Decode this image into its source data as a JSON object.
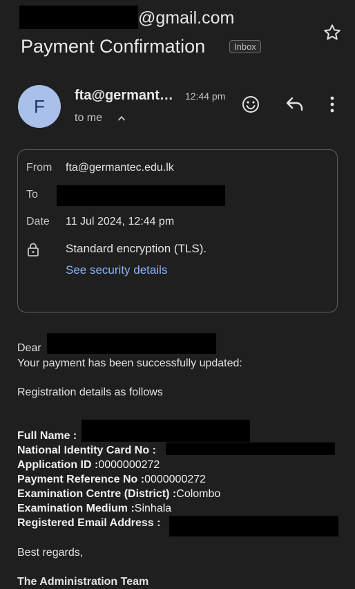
{
  "header": {
    "account_email": "@gmail.com",
    "subject": "Payment Confirmation",
    "label": "Inbox"
  },
  "message": {
    "avatar_letter": "F",
    "sender": "fta@germant…",
    "time": "12:44 pm",
    "to_me": "to me"
  },
  "details": {
    "from_label": "From",
    "from_value": "fta@germantec.edu.lk",
    "to_label": "To",
    "date_label": "Date",
    "date_value": "11 Jul 2024, 12:44 pm",
    "encryption": "Standard encryption (TLS).",
    "security_link": "See security details"
  },
  "body": {
    "greeting": "Dear",
    "line1": "Your payment has been successfully updated:",
    "line2": "Registration details as follows",
    "fields": [
      {
        "label": "Full Name :",
        "value": ""
      },
      {
        "label": "National Identity Card No :",
        "value": ""
      },
      {
        "label": "Application ID :",
        "value": "0000000272"
      },
      {
        "label": "Payment Reference No :",
        "value": "0000000272"
      },
      {
        "label": "Examination Centre (District) :",
        "value": "Colombo"
      },
      {
        "label": "Examination Medium :",
        "value": "Sinhala"
      },
      {
        "label": "Registered Email Address :",
        "value": ""
      }
    ],
    "closing": "Best regards,",
    "signature": "The Administration Team"
  },
  "icons": [
    "star-icon",
    "emoji-icon",
    "reply-icon",
    "more-icon",
    "chevron-up-icon",
    "lock-icon"
  ]
}
